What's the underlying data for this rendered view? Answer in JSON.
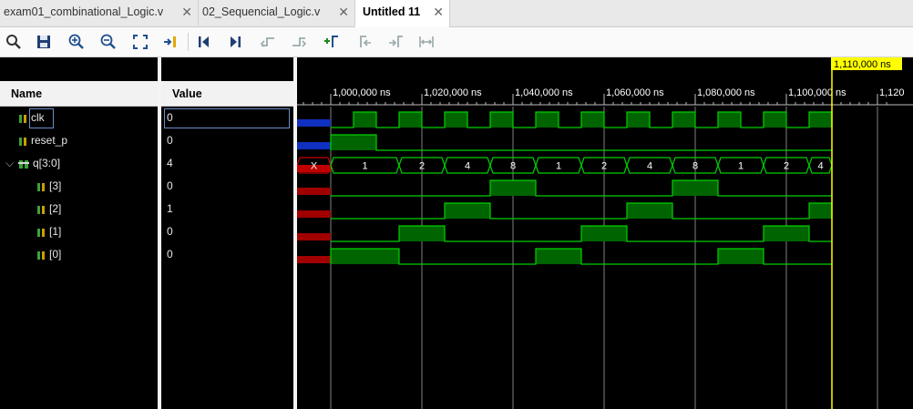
{
  "tabs": [
    {
      "label": "exam01_combinational_Logic.v",
      "active": false
    },
    {
      "label": "02_Sequencial_Logic.v",
      "active": false
    },
    {
      "label": "Untitled 11",
      "active": true
    }
  ],
  "toolbar": {
    "icons": [
      "search-icon",
      "save-icon",
      "zoom-in-icon",
      "zoom-out-icon",
      "zoom-fit-icon",
      "go-to-cursor-icon",
      "go-to-time-zero-icon",
      "go-to-last-time-icon",
      "previous-transition-icon",
      "next-transition-icon",
      "add-marker-icon",
      "previous-marker-icon",
      "next-marker-icon",
      "swap-cursors-icon"
    ]
  },
  "columns": {
    "name": "Name",
    "value": "Value"
  },
  "signals": [
    {
      "name": "clk",
      "value": "0",
      "kind": "bit",
      "indent": 0
    },
    {
      "name": "reset_p",
      "value": "0",
      "kind": "bit",
      "indent": 0
    },
    {
      "name": "q[3:0]",
      "value": "4",
      "kind": "bus",
      "indent": 0,
      "expanded": true
    },
    {
      "name": "[3]",
      "value": "0",
      "kind": "bit",
      "indent": 1
    },
    {
      "name": "[2]",
      "value": "1",
      "kind": "bit",
      "indent": 1
    },
    {
      "name": "[1]",
      "value": "0",
      "kind": "bit",
      "indent": 1
    },
    {
      "name": "[0]",
      "value": "0",
      "kind": "bit",
      "indent": 1
    }
  ],
  "wave": {
    "cursor_label": "1,110,000 ns",
    "cursor_time_ns": 1110000,
    "time_window_ns": [
      992600,
      1122000
    ],
    "ticks": [
      {
        "t": 1000000,
        "label": "1,000,000 ns"
      },
      {
        "t": 1020000,
        "label": "1,020,000 ns"
      },
      {
        "t": 1040000,
        "label": "1,040,000 ns"
      },
      {
        "t": 1060000,
        "label": "1,060,000 ns"
      },
      {
        "t": 1080000,
        "label": "1,080,000 ns"
      },
      {
        "t": 1100000,
        "label": "1,100,000 ns"
      },
      {
        "t": 1120000,
        "label": "1,120"
      }
    ],
    "clk_period_ns": 10000,
    "clk_first_rise_ns": 1005000,
    "reset_p_high_ns": [
      1000000,
      1010000
    ],
    "q_bus_segments": [
      {
        "label": "X",
        "start": 992600,
        "end": 1000000
      },
      {
        "label": "1",
        "start": 1000000,
        "end": 1015000
      },
      {
        "label": "2",
        "start": 1015000,
        "end": 1025000
      },
      {
        "label": "4",
        "start": 1025000,
        "end": 1035000
      },
      {
        "label": "8",
        "start": 1035000,
        "end": 1045000
      },
      {
        "label": "1",
        "start": 1045000,
        "end": 1055000
      },
      {
        "label": "2",
        "start": 1055000,
        "end": 1065000
      },
      {
        "label": "4",
        "start": 1065000,
        "end": 1075000
      },
      {
        "label": "8",
        "start": 1075000,
        "end": 1085000
      },
      {
        "label": "1",
        "start": 1085000,
        "end": 1095000
      },
      {
        "label": "2",
        "start": 1095000,
        "end": 1105000
      },
      {
        "label": "4",
        "start": 1105000,
        "end": 1110000
      }
    ],
    "bit_high": {
      "3": [
        [
          1035000,
          1045000
        ],
        [
          1075000,
          1085000
        ]
      ],
      "2": [
        [
          1025000,
          1035000
        ],
        [
          1065000,
          1075000
        ],
        [
          1105000,
          1110000
        ]
      ],
      "1": [
        [
          1015000,
          1025000
        ],
        [
          1055000,
          1065000
        ],
        [
          1095000,
          1105000
        ]
      ],
      "0": [
        [
          1000000,
          1015000
        ],
        [
          1045000,
          1055000
        ],
        [
          1085000,
          1095000
        ]
      ]
    },
    "colors": {
      "wave": "#00d000",
      "fill": "#006400",
      "cursor": "#ffff00",
      "grid": "#808080",
      "x_state": "#c80000",
      "label": "#ffffff"
    }
  }
}
